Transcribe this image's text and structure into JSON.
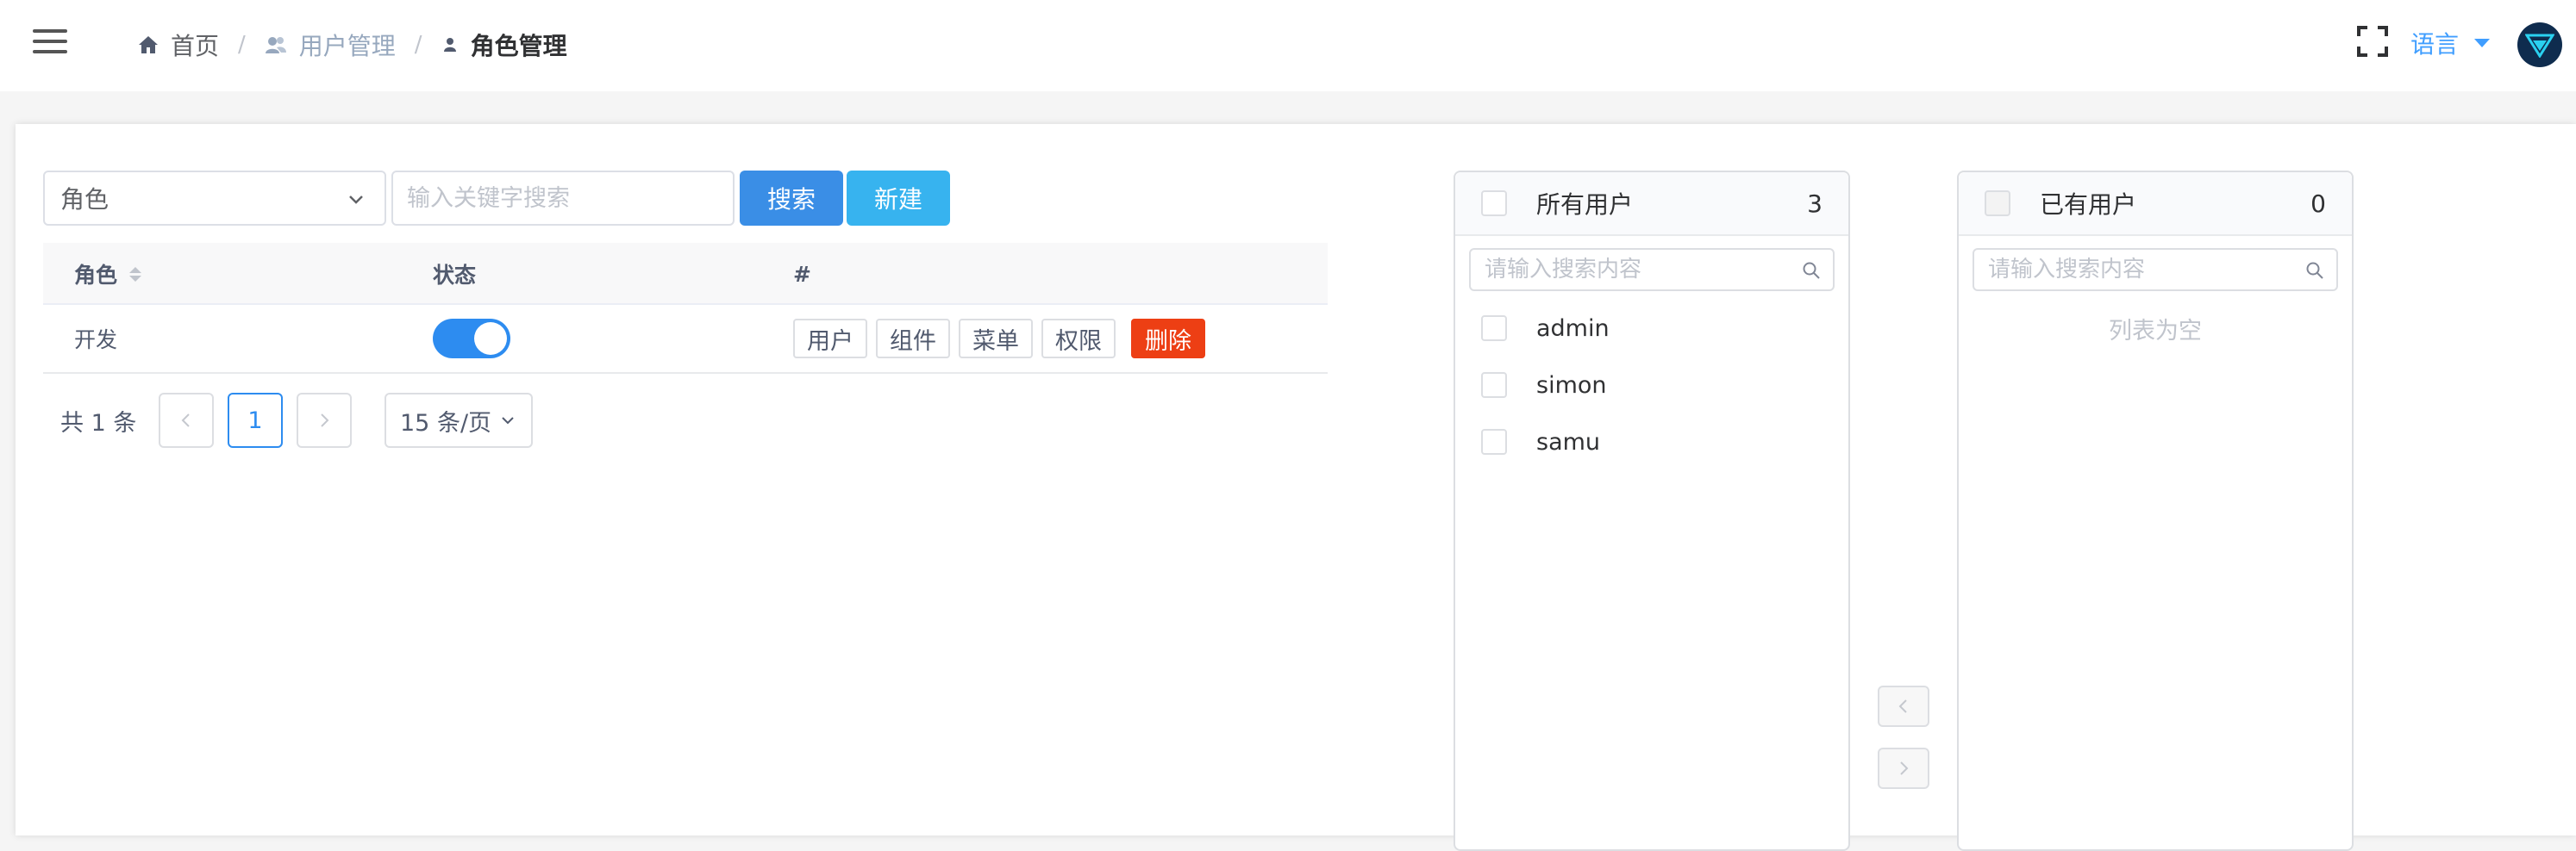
{
  "breadcrumb": {
    "home": "首页",
    "users": "用户管理",
    "roles": "角色管理"
  },
  "header": {
    "language_label": "语言",
    "accent_color": "#409eff"
  },
  "toolbar": {
    "field_select_value": "角色",
    "search_placeholder": "输入关键字搜索",
    "search_button": "搜索",
    "new_button": "新建"
  },
  "table": {
    "columns": [
      "角色",
      "状态",
      "#"
    ],
    "rows": [
      {
        "role": "开发",
        "enabled": true,
        "actions": [
          "用户",
          "组件",
          "菜单",
          "权限"
        ],
        "delete_label": "删除"
      }
    ]
  },
  "pagination": {
    "total_text": "共 1 条",
    "current_page": "1",
    "page_size": "15 条/页"
  },
  "transfer": {
    "left": {
      "title": "所有用户",
      "count": "3",
      "search_placeholder": "请输入搜索内容",
      "items": [
        "admin",
        "simon",
        "samu"
      ]
    },
    "right": {
      "title": "已有用户",
      "count": "0",
      "search_placeholder": "请输入搜索内容",
      "empty_text": "列表为空"
    }
  }
}
